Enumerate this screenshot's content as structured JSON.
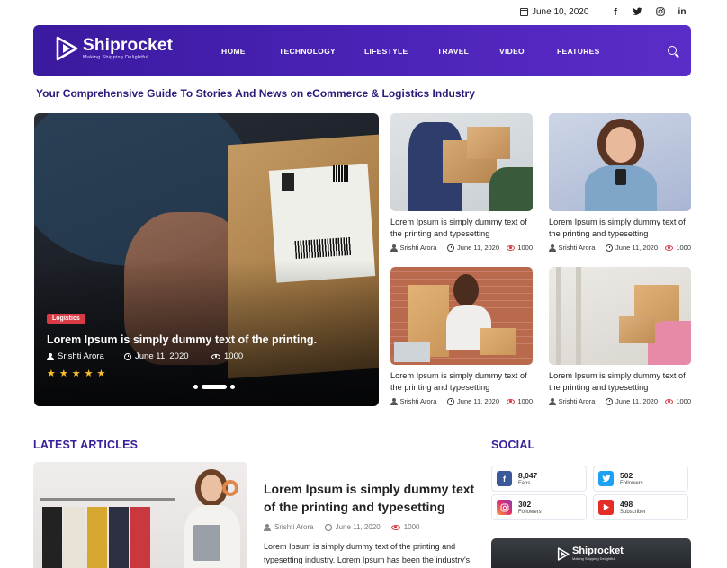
{
  "topbar": {
    "date": "June 10, 2020",
    "social": [
      {
        "icon": "facebook-icon",
        "glyph": "f"
      },
      {
        "icon": "twitter-icon",
        "glyph": "t"
      },
      {
        "icon": "instagram-icon",
        "glyph": "ig"
      },
      {
        "icon": "linkedin-icon",
        "glyph": "in"
      }
    ]
  },
  "brand": {
    "name": "Shiprocket",
    "tagline": "Making Shipping Delightful"
  },
  "nav": {
    "items": [
      "HOME",
      "TECHNOLOGY",
      "LIFESTYLE",
      "TRAVEL",
      "VIDEO",
      "FEATURES"
    ]
  },
  "page_tagline": "Your Comprehensive Guide To Stories And News on eCommerce & Logistics Industry",
  "hero": {
    "badge": "Logistics",
    "title": "Lorem Ipsum is simply dummy text of the printing.",
    "author": "Srishti Arora",
    "date": "June 11, 2020",
    "views": "1000",
    "rating": 5,
    "slide_count": 3,
    "active_slide": 2
  },
  "cards": [
    {
      "title": "Lorem Ipsum is simply dummy text of the printing and typesetting",
      "author": "Srishti Arora",
      "date": "June 11, 2020",
      "views": "1000"
    },
    {
      "title": "Lorem Ipsum is simply dummy text of the printing and typesetting",
      "author": "Srishti Arora",
      "date": "June 11, 2020",
      "views": "1000"
    },
    {
      "title": "Lorem Ipsum is simply dummy text of the printing and typesetting",
      "author": "Srishti Arora",
      "date": "June 11, 2020",
      "views": "1000"
    },
    {
      "title": "Lorem Ipsum is simply dummy text of the printing and typesetting",
      "author": "Srishti Arora",
      "date": "June 11, 2020",
      "views": "1000"
    }
  ],
  "latest": {
    "heading": "LATEST ARTICLES",
    "title": "Lorem Ipsum is simply dummy text of the printing and typesetting",
    "author": "Srishti Arora",
    "date": "June 11, 2020",
    "views": "1000",
    "excerpt": "Lorem Ipsum is simply dummy text of the printing and typesetting industry. Lorem Ipsum has been the industry's standard dummy text ever since"
  },
  "social": {
    "heading": "SOCIAL",
    "stats": [
      {
        "network": "facebook",
        "count": "8,047",
        "label": "Fans",
        "color": "#3b5998"
      },
      {
        "network": "twitter",
        "count": "502",
        "label": "Followers",
        "color": "#1da1f2"
      },
      {
        "network": "instagram",
        "count": "302",
        "label": "Followers",
        "color": "#e1306c"
      },
      {
        "network": "youtube",
        "count": "498",
        "label": "Subscriber",
        "color": "#e52d27"
      }
    ],
    "promo_brand": "Shiprocket",
    "promo_tagline": "Making Shipping Delightful"
  },
  "colors": {
    "brand_purple": "#4a22b6",
    "heading_purple": "#3a1f9a",
    "accent_red": "#d93a45",
    "star_yellow": "#f7c02b"
  }
}
